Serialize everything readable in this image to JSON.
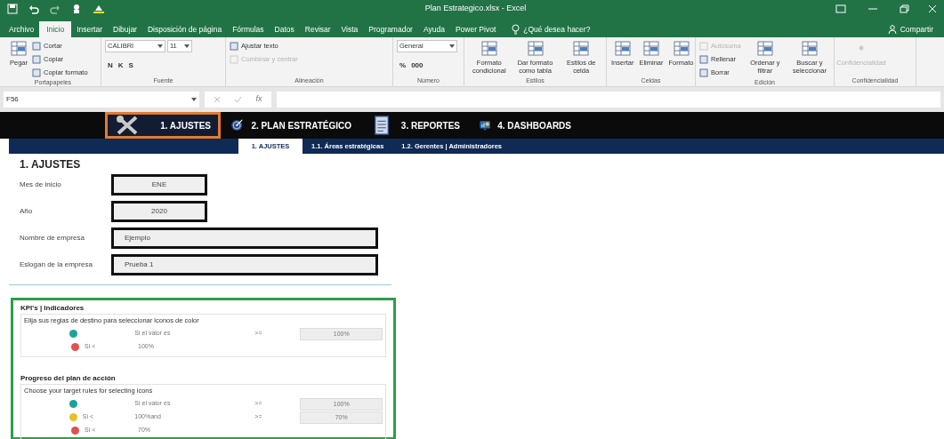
{
  "window": {
    "title": "Plan Estrategico.xlsx - Excel",
    "share": "Compartir"
  },
  "menu_tabs": [
    {
      "label": "Archivo",
      "selected": false
    },
    {
      "label": "Inicio",
      "selected": true
    },
    {
      "label": "Insertar",
      "selected": false
    },
    {
      "label": "Dibujar",
      "selected": false
    },
    {
      "label": "Disposición de página",
      "selected": false
    },
    {
      "label": "Fórmulas",
      "selected": false
    },
    {
      "label": "Datos",
      "selected": false
    },
    {
      "label": "Revisar",
      "selected": false
    },
    {
      "label": "Vista",
      "selected": false
    },
    {
      "label": "Programador",
      "selected": false
    },
    {
      "label": "Ayuda",
      "selected": false
    },
    {
      "label": "Power Pivot",
      "selected": false
    }
  ],
  "tell_me": {
    "placeholder": "¿Qué desea hacer?"
  },
  "ribbon_groups": [
    {
      "label": "Portapapeles",
      "columns": [
        [
          {
            "kind": "large",
            "label": "Pegar",
            "disabled": false
          }
        ],
        [
          {
            "kind": "small",
            "label": "Cortar",
            "disabled": false
          },
          {
            "kind": "small",
            "label": "Copiar",
            "disabled": false
          },
          {
            "kind": "small",
            "label": "Copiar formato",
            "disabled": false
          }
        ]
      ]
    },
    {
      "label": "Fuente",
      "columns": [
        [
          {
            "kind": "combo",
            "value": "CALIBRI",
            "size": "11"
          },
          {
            "kind": "glyphs",
            "glyphs": [
              "N",
              "K",
              "S"
            ]
          }
        ]
      ]
    },
    {
      "label": "Alineación",
      "columns": [
        [
          {
            "kind": "small",
            "label": "Ajustar texto",
            "disabled": false
          },
          {
            "kind": "small",
            "label": "Combinar y centrar",
            "disabled": true
          }
        ]
      ]
    },
    {
      "label": "Número",
      "columns": [
        [
          {
            "kind": "combo",
            "value": "General"
          },
          {
            "kind": "glyphs",
            "glyphs": [
              "%",
              "000"
            ]
          }
        ]
      ]
    },
    {
      "label": "Estilos",
      "columns": [
        [
          {
            "kind": "large",
            "label": "Formato condicional",
            "disabled": false
          }
        ],
        [
          {
            "kind": "large",
            "label": "Dar formato como tabla",
            "disabled": false
          }
        ],
        [
          {
            "kind": "large",
            "label": "Estilos de celda",
            "disabled": false
          }
        ]
      ]
    },
    {
      "label": "Celdas",
      "columns": [
        [
          {
            "kind": "large",
            "label": "Insertar",
            "disabled": false
          }
        ],
        [
          {
            "kind": "large",
            "label": "Eliminar",
            "disabled": false
          }
        ],
        [
          {
            "kind": "large",
            "label": "Formato",
            "disabled": false
          }
        ]
      ]
    },
    {
      "label": "Edición",
      "columns": [
        [
          {
            "kind": "small",
            "label": "Autosuma",
            "disabled": true
          },
          {
            "kind": "small",
            "label": "Rellenar",
            "disabled": false
          },
          {
            "kind": "small",
            "label": "Borrar",
            "disabled": false
          }
        ],
        [
          {
            "kind": "large",
            "label": "Ordenar y filtrar",
            "disabled": false
          }
        ],
        [
          {
            "kind": "large",
            "label": "Buscar y seleccionar",
            "disabled": false
          }
        ]
      ]
    },
    {
      "label": "Confidencialidad",
      "columns": [
        [
          {
            "kind": "large",
            "label": "Confidencialidad",
            "disabled": true
          }
        ]
      ]
    }
  ],
  "formula_bar": {
    "name_box": "F56",
    "function_label": "fx"
  },
  "nav_tabs": [
    {
      "label": "1. AJUSTES",
      "selected": true,
      "kind": "tools"
    },
    {
      "label": "2. PLAN ESTRATÉGICO",
      "selected": false,
      "kind": "target"
    },
    {
      "label": "3. REPORTES",
      "selected": false,
      "kind": "document"
    },
    {
      "label": "4. DASHBOARDS",
      "selected": false,
      "kind": "chart"
    }
  ],
  "sub_tabs": [
    {
      "label": "1. AJUSTES",
      "selected": true
    },
    {
      "label": "1.1. Áreas estratégicas",
      "selected": false
    },
    {
      "label": "1.2. Gerentes | Administradores",
      "selected": false
    }
  ],
  "settings": {
    "title": "1. AJUSTES",
    "fields": [
      {
        "label": "Mes de inicio",
        "value": "ENE",
        "kind": "short"
      },
      {
        "label": "Año",
        "value": "2020",
        "kind": "short"
      },
      {
        "label": "Nombre de empresa",
        "value": "Ejemplo",
        "kind": "long"
      },
      {
        "label": "Eslogan de la empresa",
        "value": "Prueba 1",
        "kind": "long"
      }
    ]
  },
  "kpi_sections": [
    {
      "title": "KPI's | Indicadores",
      "subtitle": "Elija sus reglas de destino para seleccionar iconos de color",
      "rules": [
        {
          "color": "#1aa39a",
          "middle": "Si el valor es",
          "compare": ">=",
          "threshold": "100%"
        },
        {
          "color": "#e0524f",
          "prefix": "Si <",
          "middle": "100%"
        }
      ]
    },
    {
      "title": "Progreso del plan de acción",
      "subtitle": "Choose your target rules for selecting icons",
      "rules": [
        {
          "color": "#1aa39a",
          "middle": "Si el valor es",
          "compare": ">=",
          "threshold": "100%"
        },
        {
          "color": "#e8c12a",
          "prefix": "Si <",
          "middle": "100%and",
          "compare": ">=",
          "threshold": "70%"
        },
        {
          "color": "#e0524f",
          "prefix": "Si <",
          "middle": "70%"
        }
      ]
    }
  ]
}
